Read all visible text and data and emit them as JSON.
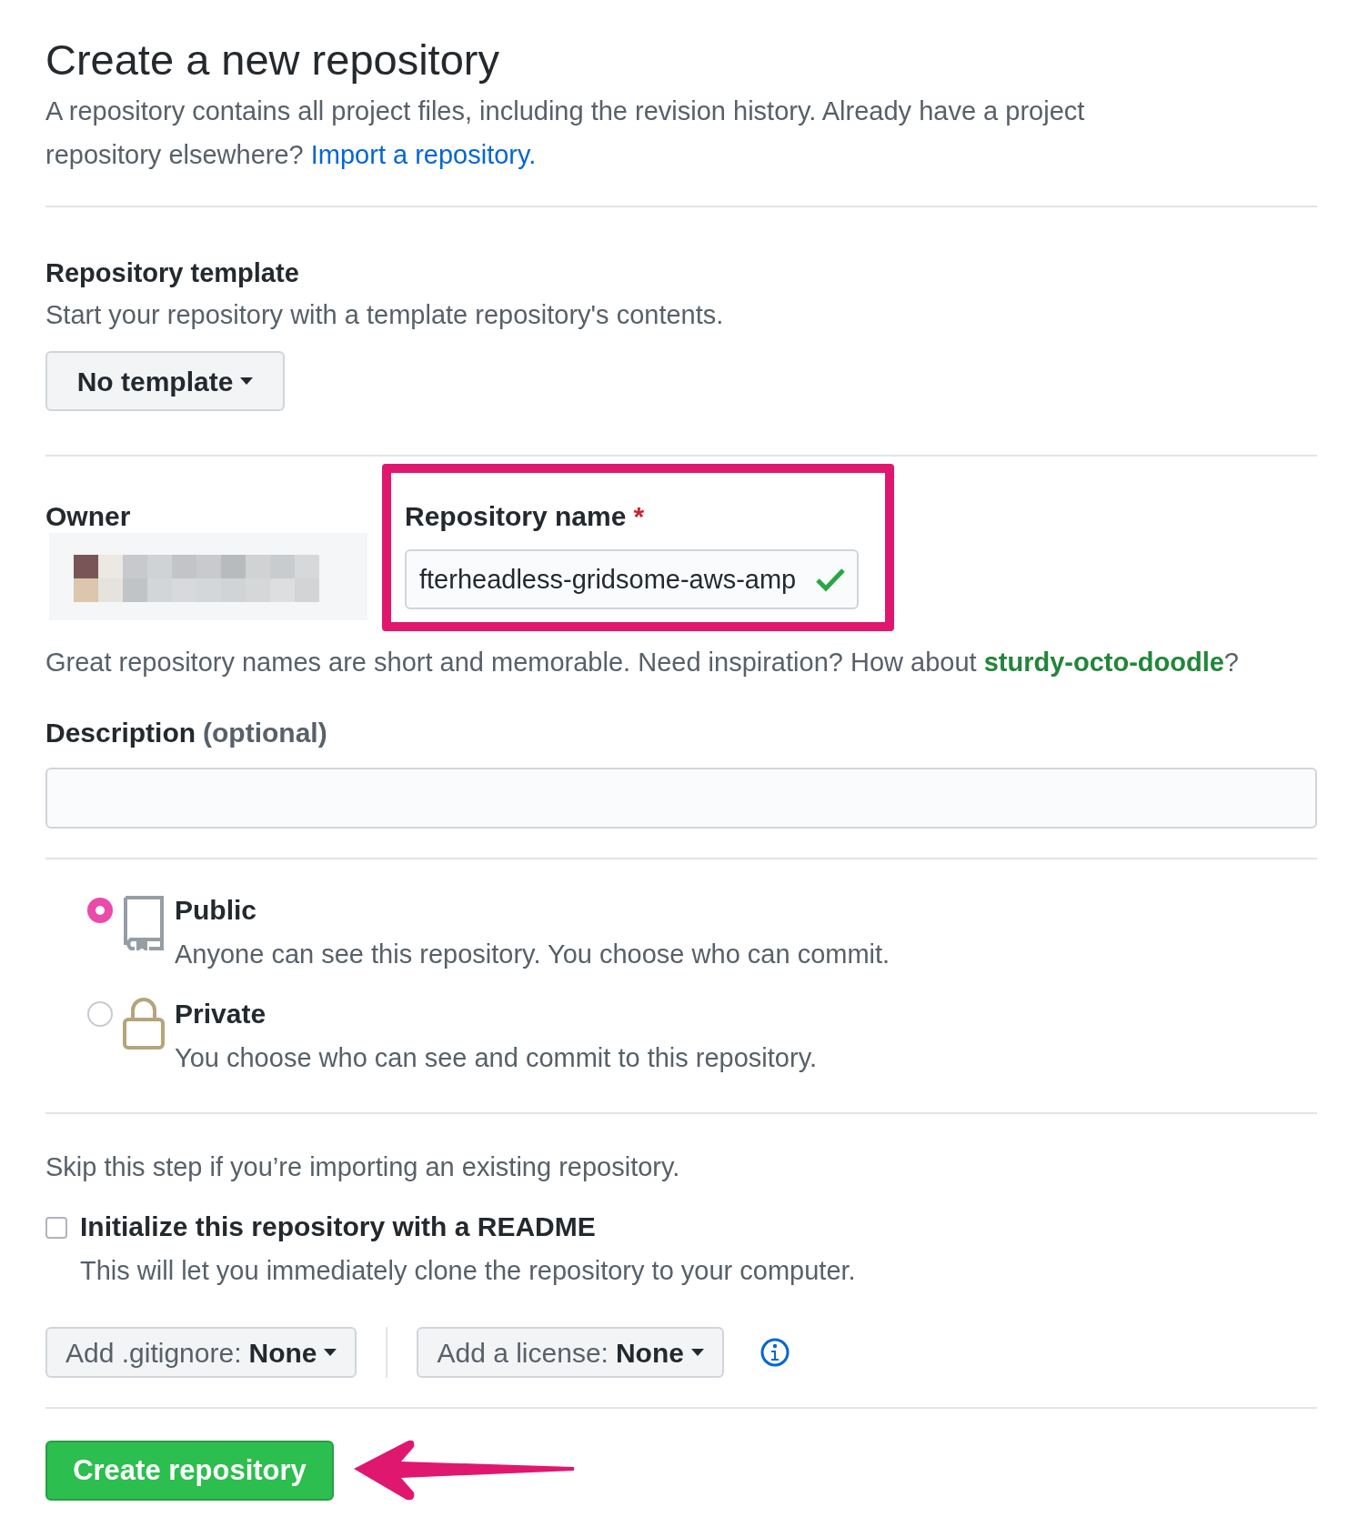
{
  "page": {
    "title": "Create a new repository",
    "description": "A repository contains all project files, including the revision history. Already have a project repository elsewhere?",
    "import_link": "Import a repository."
  },
  "template": {
    "label": "Repository template",
    "hint": "Start your repository with a template repository's contents.",
    "button": "No template"
  },
  "owner": {
    "label": "Owner"
  },
  "repo_name": {
    "label": "Repository name",
    "required_mark": "*",
    "value": "fterheadless-gridsome-aws-amp",
    "valid": true
  },
  "name_hint": {
    "text": "Great repository names are short and memorable. Need inspiration? How about",
    "suggestion": "sturdy-octo-doodle",
    "end": "?"
  },
  "description": {
    "label": "Description",
    "optional": "(optional)"
  },
  "visibility": [
    {
      "kind": "public",
      "label": "Public",
      "hint": "Anyone can see this repository. You choose who can commit.",
      "selected": true
    },
    {
      "kind": "private",
      "label": "Private",
      "hint": "You choose who can see and commit to this repository.",
      "selected": false
    }
  ],
  "import_note": "Skip this step if you’re importing an existing repository.",
  "readme": {
    "label": "Initialize this repository with a README",
    "hint": "This will let you immediately clone the repository to your computer.",
    "checked": false
  },
  "selects": [
    {
      "label": "Add .gitignore:",
      "value": "None"
    },
    {
      "label": "Add a license:",
      "value": "None"
    }
  ],
  "submit": "Create repository"
}
